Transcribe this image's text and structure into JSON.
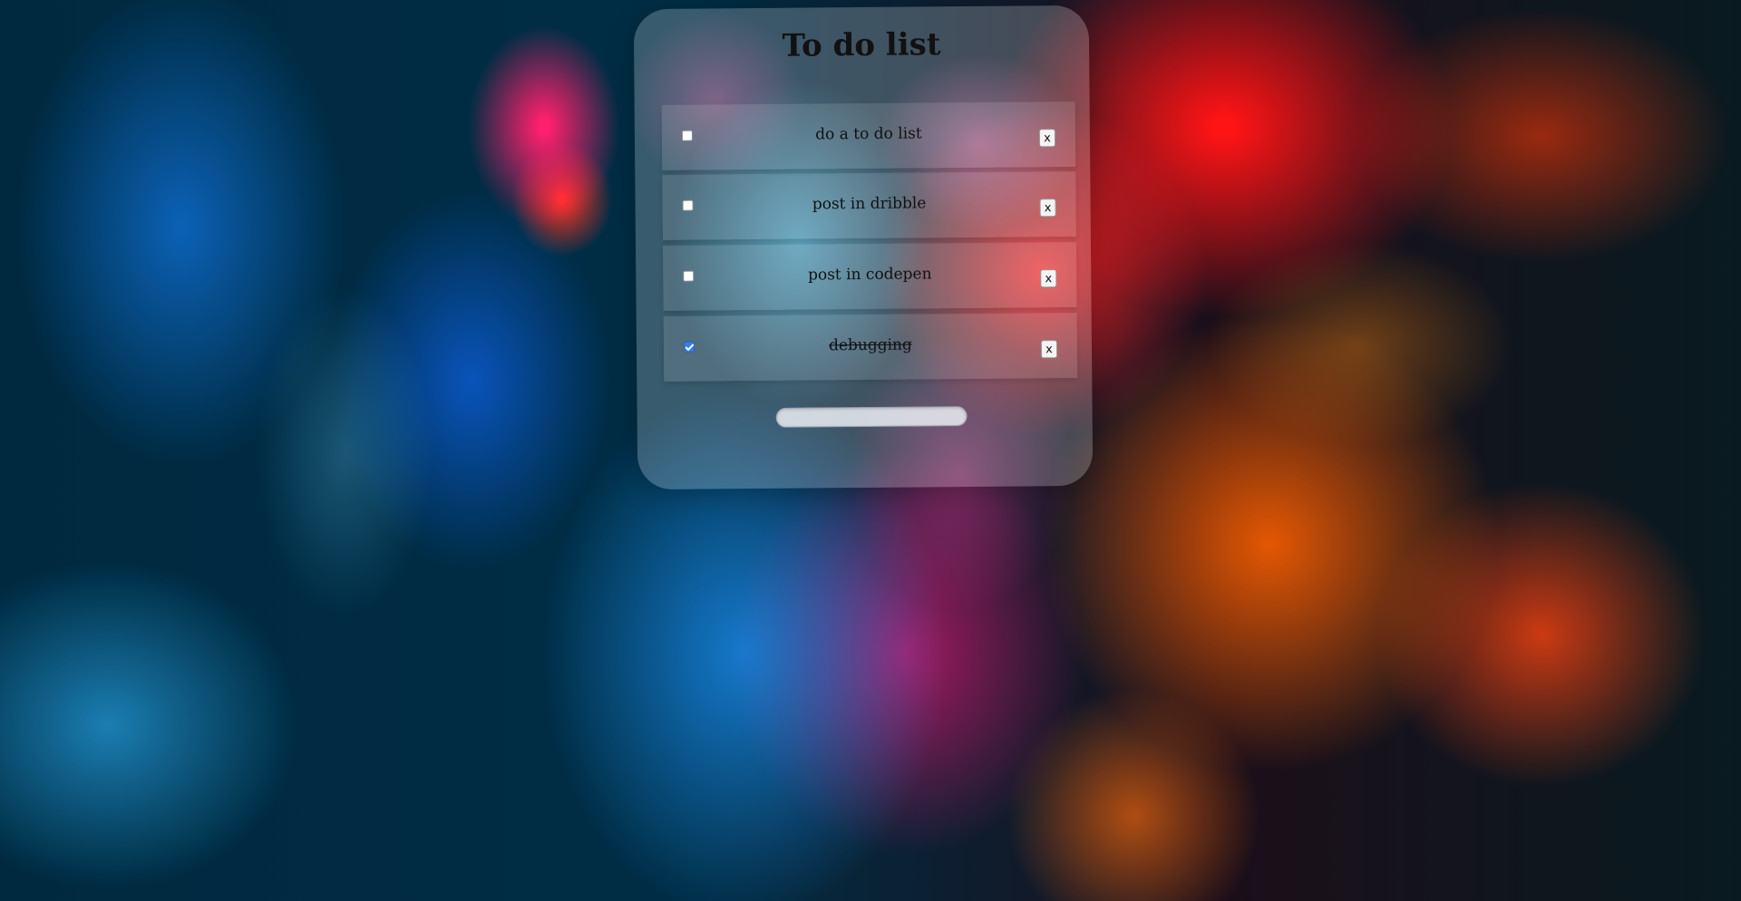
{
  "app": {
    "title": "To do list"
  },
  "todos": [
    {
      "text": "do a to do list",
      "completed": false,
      "delete_label": "x"
    },
    {
      "text": "post in dribble",
      "completed": false,
      "delete_label": "x"
    },
    {
      "text": "post in codepen",
      "completed": false,
      "delete_label": "x"
    },
    {
      "text": "debugging",
      "completed": true,
      "delete_label": "x"
    }
  ],
  "new_todo": {
    "value": "",
    "placeholder": ""
  }
}
